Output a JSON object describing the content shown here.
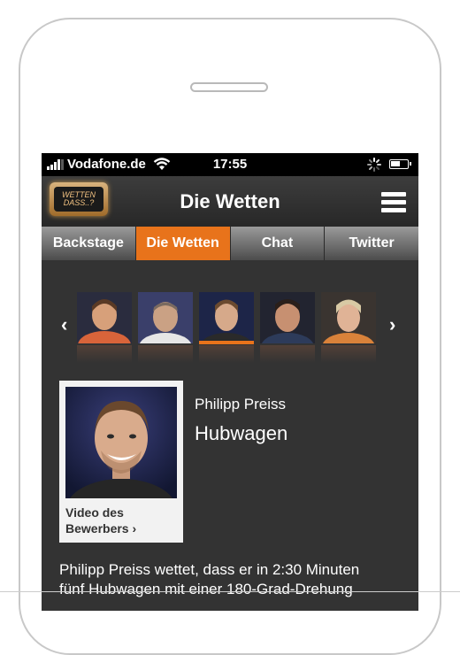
{
  "statusbar": {
    "carrier": "Vodafone.de",
    "time": "17:55",
    "signal_bars": 4,
    "battery_level": 0.6
  },
  "navbar": {
    "title": "Die Wetten",
    "logo_line1": "WETTEN",
    "logo_line2": "DASS..?"
  },
  "tabs": [
    {
      "label": "Backstage",
      "active": false
    },
    {
      "label": "Die Wetten",
      "active": true
    },
    {
      "label": "Chat",
      "active": false
    },
    {
      "label": "Twitter",
      "active": false
    }
  ],
  "carousel": {
    "prev_arrow": "‹",
    "next_arrow": "›",
    "selected_index": 2
  },
  "candidate": {
    "video_label_line1": "Video des",
    "video_label_line2": "Bewerbers",
    "video_chevron": "›",
    "name": "Philipp Preiss",
    "bet_title": "Hubwagen",
    "description_line1": "Philipp Preiss wettet, dass er in 2:30 Minuten",
    "description_line2": "fünf Hubwagen mit einer 180-Grad-Drehung"
  },
  "colors": {
    "accent": "#e8731b",
    "background": "#333333"
  }
}
